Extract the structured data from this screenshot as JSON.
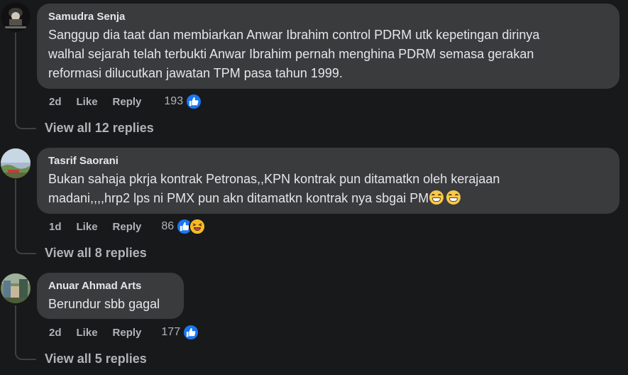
{
  "comments": [
    {
      "author": "Samudra Senja",
      "text": "Sanggup dia taat dan membiarkan Anwar Ibrahim control PDRM utk kepetingan dirinya\nwalhal sejarah telah terbukti Anwar Ibrahim pernah menghina PDRM semasa gerakan\nreformasi dilucutkan jawatan TPM pasa tahun 1999.",
      "time": "2d",
      "like_label": "Like",
      "reply_label": "Reply",
      "reaction_count": "193",
      "reactions": [
        "like-icon"
      ],
      "view_replies": "View all 12 replies"
    },
    {
      "author": "Tasrif Saorani",
      "text_lines": [
        "Bukan sahaja pkrja kontrak Petronas,,KPN kontrak pun ditamatkn oleh kerajaan",
        "madani,,,,hrp2 lps ni PMX pun akn ditamatkn kontrak nya sbgai PM"
      ],
      "text_emojis": [
        "grinning-face-emoji",
        "grinning-face-emoji"
      ],
      "time": "1d",
      "like_label": "Like",
      "reply_label": "Reply",
      "reaction_count": "86",
      "reactions": [
        "like-icon",
        "haha-icon"
      ],
      "view_replies": "View all 8 replies"
    },
    {
      "author": "Anuar Ahmad Arts",
      "text": "Berundur sbb gagal",
      "time": "2d",
      "like_label": "Like",
      "reply_label": "Reply",
      "reaction_count": "177",
      "reactions": [
        "like-icon"
      ],
      "view_replies": "View all 5 replies"
    }
  ],
  "colors": {
    "background": "#18191a",
    "bubble": "#3a3b3c",
    "primary_text": "#e4e6eb",
    "secondary_text": "#b0b3b8",
    "like_blue": "#1877f2",
    "haha_yellow": "#f7b928"
  }
}
